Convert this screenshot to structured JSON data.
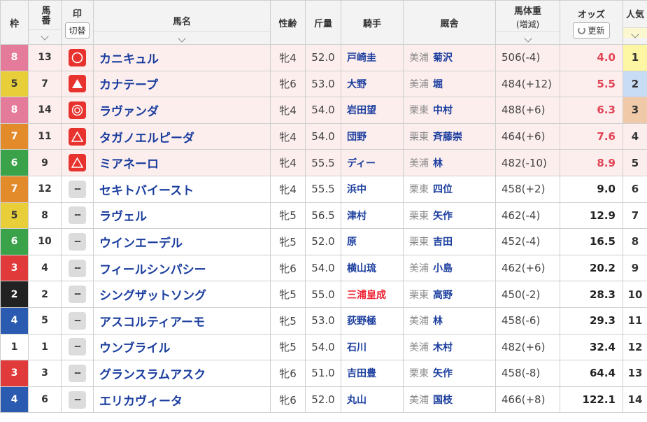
{
  "headers": {
    "waku": "枠",
    "umaban": "馬番",
    "mark": "印",
    "mark_toggle": "切替",
    "horse": "馬名",
    "sexage": "性齢",
    "weight": "斤量",
    "jockey": "騎手",
    "stable": "厩舎",
    "body_weight": "馬体重",
    "body_weight_sub": "(増減)",
    "odds": "オッズ",
    "odds_update": "更新",
    "ninki": "人気"
  },
  "colors": {
    "waku_1": "#ffffff",
    "waku_2": "#222222",
    "waku_3": "#e03a3a",
    "waku_4": "#2a5bb0",
    "waku_5": "#e8cf3a",
    "waku_6": "#3aa34a",
    "waku_7": "#e38a2a",
    "waku_8": "#e57b9a",
    "ninki_1": "#fdf6a3",
    "ninki_2": "#c9dcf5",
    "ninki_3": "#f0caa8",
    "highlight_row": "#fdeeee"
  },
  "rows": [
    {
      "waku": "8",
      "umaban": "13",
      "mark": "circle",
      "horse": "カニキュル",
      "sexage": "牝4",
      "weight": "52.0",
      "jockey": "戸崎圭",
      "reg": "美浦",
      "trainer": "菊沢",
      "body_weight": "506(-4)",
      "odds": "4.0",
      "ninki": "1"
    },
    {
      "waku": "5",
      "umaban": "7",
      "mark": "filled-triangle",
      "horse": "カナテープ",
      "sexage": "牝6",
      "weight": "53.0",
      "jockey": "大野",
      "reg": "美浦",
      "trainer": "堀",
      "body_weight": "484(+12)",
      "odds": "5.5",
      "ninki": "2"
    },
    {
      "waku": "8",
      "umaban": "14",
      "mark": "double-circle",
      "horse": "ラヴァンダ",
      "sexage": "牝4",
      "weight": "54.0",
      "jockey": "岩田望",
      "reg": "栗東",
      "trainer": "中村",
      "body_weight": "488(+6)",
      "odds": "6.3",
      "ninki": "3"
    },
    {
      "waku": "7",
      "umaban": "11",
      "mark": "triangle",
      "horse": "タガノエルピーダ",
      "sexage": "牝4",
      "weight": "54.0",
      "jockey": "団野",
      "reg": "栗東",
      "trainer": "斉藤崇",
      "body_weight": "464(+6)",
      "odds": "7.6",
      "ninki": "4"
    },
    {
      "waku": "6",
      "umaban": "9",
      "mark": "triangle",
      "horse": "ミアネーロ",
      "sexage": "牝4",
      "weight": "55.5",
      "jockey": "ディー",
      "reg": "美浦",
      "trainer": "林",
      "body_weight": "482(-10)",
      "odds": "8.9",
      "ninki": "5"
    },
    {
      "waku": "7",
      "umaban": "12",
      "mark": "none",
      "mark_text": "--",
      "horse": "セキトバイースト",
      "sexage": "牝4",
      "weight": "55.5",
      "jockey": "浜中",
      "reg": "栗東",
      "trainer": "四位",
      "body_weight": "458(+2)",
      "odds": "9.0",
      "ninki": "6"
    },
    {
      "waku": "5",
      "umaban": "8",
      "mark": "none",
      "mark_text": "--",
      "horse": "ラヴェル",
      "sexage": "牝5",
      "weight": "56.5",
      "jockey": "津村",
      "reg": "栗東",
      "trainer": "矢作",
      "body_weight": "462(-4)",
      "odds": "12.9",
      "ninki": "7"
    },
    {
      "waku": "6",
      "umaban": "10",
      "mark": "none",
      "mark_text": "--",
      "horse": "ウインエーデル",
      "sexage": "牝5",
      "weight": "52.0",
      "jockey": "原",
      "reg": "栗東",
      "trainer": "吉田",
      "body_weight": "452(-4)",
      "odds": "16.5",
      "ninki": "8"
    },
    {
      "waku": "3",
      "umaban": "4",
      "mark": "none",
      "mark_text": "--",
      "horse": "フィールシンパシー",
      "sexage": "牝6",
      "weight": "54.0",
      "jockey": "横山琉",
      "reg": "美浦",
      "trainer": "小島",
      "body_weight": "462(+6)",
      "odds": "20.2",
      "ninki": "9"
    },
    {
      "waku": "2",
      "umaban": "2",
      "mark": "none",
      "mark_text": "--",
      "horse": "シングザットソング",
      "sexage": "牝5",
      "weight": "55.0",
      "jockey": "三浦皇成",
      "reg": "栗東",
      "trainer": "高野",
      "body_weight": "450(-2)",
      "odds": "28.3",
      "ninki": "10"
    },
    {
      "waku": "4",
      "umaban": "5",
      "mark": "none",
      "mark_text": "--",
      "horse": "アスコルティアーモ",
      "sexage": "牝5",
      "weight": "53.0",
      "jockey": "荻野極",
      "reg": "美浦",
      "trainer": "林",
      "body_weight": "458(-6)",
      "odds": "29.3",
      "ninki": "11"
    },
    {
      "waku": "1",
      "umaban": "1",
      "mark": "none",
      "mark_text": "--",
      "horse": "ウンブライル",
      "sexage": "牝5",
      "weight": "54.0",
      "jockey": "石川",
      "reg": "美浦",
      "trainer": "木村",
      "body_weight": "482(+6)",
      "odds": "32.4",
      "ninki": "12"
    },
    {
      "waku": "3",
      "umaban": "3",
      "mark": "none",
      "mark_text": "--",
      "horse": "グランスラムアスク",
      "sexage": "牝6",
      "weight": "51.0",
      "jockey": "吉田豊",
      "reg": "栗東",
      "trainer": "矢作",
      "body_weight": "458(-8)",
      "odds": "64.4",
      "ninki": "13"
    },
    {
      "waku": "4",
      "umaban": "6",
      "mark": "none",
      "mark_text": "--",
      "horse": "エリカヴィータ",
      "sexage": "牝6",
      "weight": "52.0",
      "jockey": "丸山",
      "reg": "美浦",
      "trainer": "国枝",
      "body_weight": "466(+8)",
      "odds": "122.1",
      "ninki": "14"
    }
  ]
}
